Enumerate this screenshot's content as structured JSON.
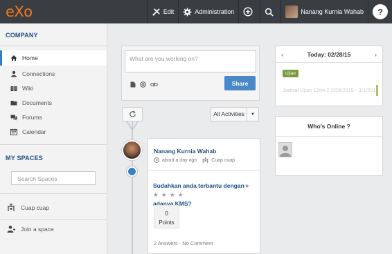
{
  "topbar": {
    "logo": "eXo",
    "edit_label": "Edit",
    "admin_label": "Administration",
    "user_name": "Nanang Kurnia Wahab",
    "help_label": "?"
  },
  "sidebar": {
    "company_heading": "COMPANY",
    "items": [
      {
        "label": "Home",
        "icon": "home-icon",
        "active": true
      },
      {
        "label": "Connections",
        "icon": "person-icon"
      },
      {
        "label": "Wiki",
        "icon": "book-icon"
      },
      {
        "label": "Documents",
        "icon": "folder-icon"
      },
      {
        "label": "Forums",
        "icon": "forum-icon"
      },
      {
        "label": "Calendar",
        "icon": "calendar-icon"
      }
    ],
    "spaces_heading": "MY SPACES",
    "search_placeholder": "Search Spaces",
    "spaces": [
      {
        "label": "Cuap cuap",
        "icon": "space-icon"
      }
    ],
    "join_label": "Join a space"
  },
  "composer": {
    "placeholder": "What are you working on?",
    "share_label": "Share"
  },
  "stream": {
    "filter_label": "All Activities"
  },
  "activity": {
    "author": "Nanang Kurnia Wahab",
    "time": "about a day ago",
    "space": "Cuap cuap",
    "question_line1": "Sudahkan anda terbantu dengan",
    "stars": "★ ★ ★ ★ ★",
    "question_line2": "adanya KMS?",
    "points_value": "0",
    "points_label": "Points",
    "footer": "2 Answers - No Comment"
  },
  "calendar": {
    "today": "Today: 02/28/15",
    "prev": "‹",
    "next": "›",
    "badge": "Ujian",
    "event": "Jadwal Ujian 12mi-2 2/28/2015 - 3/1/2015"
  },
  "online": {
    "heading": "Who's Online ?"
  },
  "colors": {
    "topbar": "#3a3d41",
    "logo": "#f47920",
    "accent": "#4a88c9",
    "link": "#1d4d84",
    "event": "#7c9a3d"
  }
}
